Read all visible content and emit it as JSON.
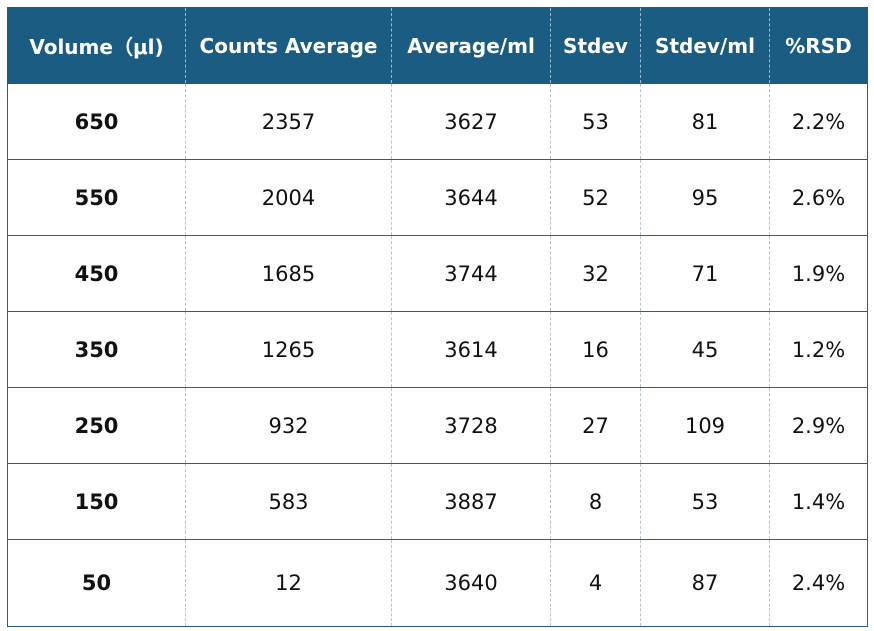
{
  "table": {
    "header_color": "#1b5c82",
    "columns": [
      "Volume（μl)",
      "Counts Average",
      "Average/ml",
      "Stdev",
      "Stdev/ml",
      "%RSD"
    ],
    "rows": [
      [
        "650",
        "2357",
        "3627",
        "53",
        "81",
        "2.2%"
      ],
      [
        "550",
        "2004",
        "3644",
        "52",
        "95",
        "2.6%"
      ],
      [
        "450",
        "1685",
        "3744",
        "32",
        "71",
        "1.9%"
      ],
      [
        "350",
        "1265",
        "3614",
        "16",
        "45",
        "1.2%"
      ],
      [
        "250",
        "932",
        "3728",
        "27",
        "109",
        "2.9%"
      ],
      [
        "150",
        "583",
        "3887",
        "8",
        "53",
        "1.4%"
      ],
      [
        "50",
        "12",
        "3640",
        "4",
        "87",
        "2.4%"
      ]
    ]
  }
}
